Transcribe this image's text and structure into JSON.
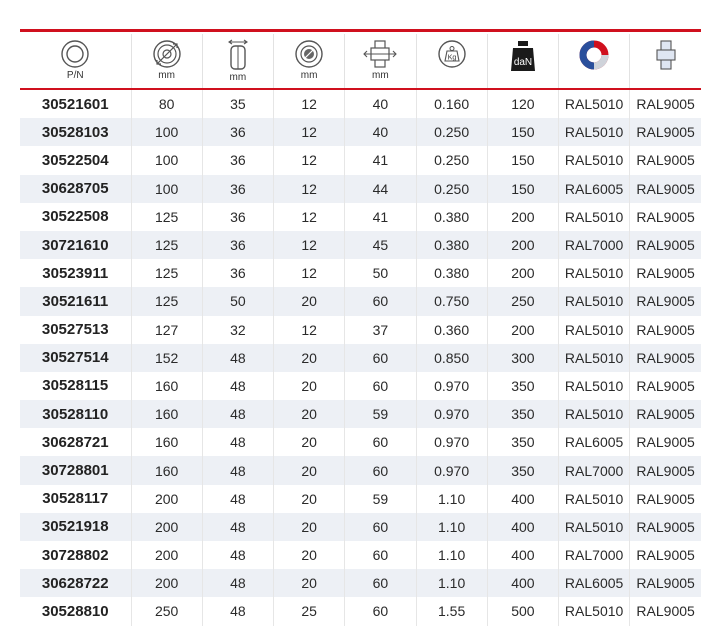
{
  "header": {
    "units": [
      "P/N",
      "mm",
      "mm",
      "mm",
      "mm",
      "",
      "",
      "",
      ""
    ],
    "weight_icon_label": "Kg",
    "load_icon_label": "daN",
    "icons": [
      "part-number-ring-icon",
      "wheel-diameter-icon",
      "wheel-width-icon",
      "bore-diameter-icon",
      "hub-length-icon",
      "weight-kg-icon",
      "load-capacity-dan-icon",
      "wheel-color-icon",
      "hub-color-icon"
    ],
    "colors": {
      "accent_red": "#d0101e",
      "stripe": "#edf0f5",
      "ring_blue": "#2a4f9c",
      "ring_red": "#d0101e"
    }
  },
  "rows": [
    [
      "30521601",
      "80",
      "35",
      "12",
      "40",
      "0.160",
      "120",
      "RAL5010",
      "RAL9005"
    ],
    [
      "30528103",
      "100",
      "36",
      "12",
      "40",
      "0.250",
      "150",
      "RAL5010",
      "RAL9005"
    ],
    [
      "30522504",
      "100",
      "36",
      "12",
      "41",
      "0.250",
      "150",
      "RAL5010",
      "RAL9005"
    ],
    [
      "30628705",
      "100",
      "36",
      "12",
      "44",
      "0.250",
      "150",
      "RAL6005",
      "RAL9005"
    ],
    [
      "30522508",
      "125",
      "36",
      "12",
      "41",
      "0.380",
      "200",
      "RAL5010",
      "RAL9005"
    ],
    [
      "30721610",
      "125",
      "36",
      "12",
      "45",
      "0.380",
      "200",
      "RAL7000",
      "RAL9005"
    ],
    [
      "30523911",
      "125",
      "36",
      "12",
      "50",
      "0.380",
      "200",
      "RAL5010",
      "RAL9005"
    ],
    [
      "30521611",
      "125",
      "50",
      "20",
      "60",
      "0.750",
      "250",
      "RAL5010",
      "RAL9005"
    ],
    [
      "30527513",
      "127",
      "32",
      "12",
      "37",
      "0.360",
      "200",
      "RAL5010",
      "RAL9005"
    ],
    [
      "30527514",
      "152",
      "48",
      "20",
      "60",
      "0.850",
      "300",
      "RAL5010",
      "RAL9005"
    ],
    [
      "30528115",
      "160",
      "48",
      "20",
      "60",
      "0.970",
      "350",
      "RAL5010",
      "RAL9005"
    ],
    [
      "30528110",
      "160",
      "48",
      "20",
      "59",
      "0.970",
      "350",
      "RAL5010",
      "RAL9005"
    ],
    [
      "30628721",
      "160",
      "48",
      "20",
      "60",
      "0.970",
      "350",
      "RAL6005",
      "RAL9005"
    ],
    [
      "30728801",
      "160",
      "48",
      "20",
      "60",
      "0.970",
      "350",
      "RAL7000",
      "RAL9005"
    ],
    [
      "30528117",
      "200",
      "48",
      "20",
      "59",
      "1.10",
      "400",
      "RAL5010",
      "RAL9005"
    ],
    [
      "30521918",
      "200",
      "48",
      "20",
      "60",
      "1.10",
      "400",
      "RAL5010",
      "RAL9005"
    ],
    [
      "30728802",
      "200",
      "48",
      "20",
      "60",
      "1.10",
      "400",
      "RAL7000",
      "RAL9005"
    ],
    [
      "30628722",
      "200",
      "48",
      "20",
      "60",
      "1.10",
      "400",
      "RAL6005",
      "RAL9005"
    ],
    [
      "30528810",
      "250",
      "48",
      "25",
      "60",
      "1.55",
      "500",
      "RAL5010",
      "RAL9005"
    ]
  ]
}
